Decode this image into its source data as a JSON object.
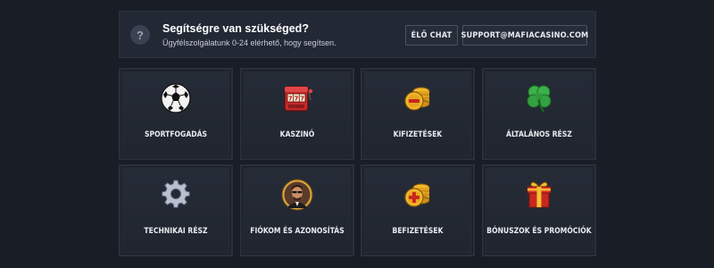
{
  "help": {
    "title": "Segítségre van szükséged?",
    "subtitle": "Ügyfélszolgálatunk 0-24 elérhető, hogy segítsen.",
    "icon_glyph": "?",
    "chat_label": "ÉLŐ CHAT",
    "email_label": "SUPPORT@MAFIACASINO.COM"
  },
  "categories": [
    {
      "label": "SPORTFOGADÁS",
      "icon": "soccer-ball-icon"
    },
    {
      "label": "KASZINÓ",
      "icon": "slot-machine-icon"
    },
    {
      "label": "KIFIZETÉSEK",
      "icon": "coins-minus-icon"
    },
    {
      "label": "ÁLTALÁNOS RÉSZ",
      "icon": "clover-icon"
    },
    {
      "label": "TECHNIKAI RÉSZ",
      "icon": "gear-icon"
    },
    {
      "label": "FIÓKOM ÉS AZONOSÍTÁS",
      "icon": "avatar-icon"
    },
    {
      "label": "BEFIZETÉSEK",
      "icon": "coins-plus-icon"
    },
    {
      "label": "BÓNUSZOK ÉS PROMÓCIÓK",
      "icon": "gift-box-icon"
    }
  ]
}
